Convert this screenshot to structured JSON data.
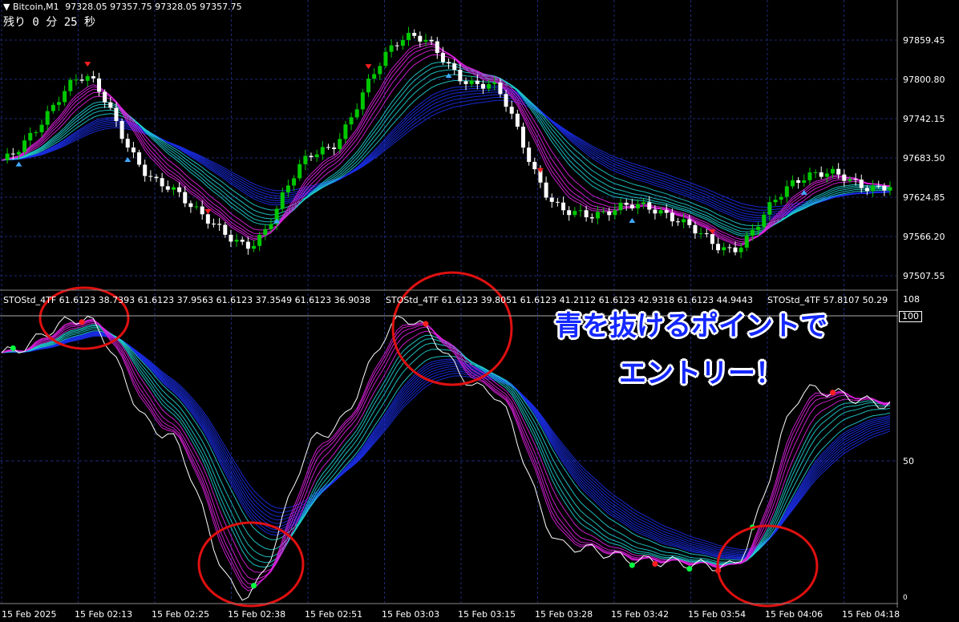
{
  "header": {
    "symbol": "Bitcoin,M1",
    "ohlc": "97328.05 97357.75 97328.05 97357.75",
    "timer": "残り 0 分 25 秒"
  },
  "price_axis": [
    "97859.45",
    "97800.80",
    "97742.15",
    "97683.50",
    "97624.85",
    "97566.20",
    "97507.55"
  ],
  "oscillator": {
    "info": [
      "STOStd_4TF 61.6123 38.7393 61.6123 37.9563 61.6123 37.3549 61.6123 36.9038",
      "STOStd_4TF 61.6123 39.8051 61.6123 41.2112 61.6123 42.9318 61.6123 44.9443",
      "STOStd_4TF 57.8107 50.29"
    ],
    "levels": [
      "108",
      "100",
      "50",
      "0"
    ]
  },
  "time_axis": [
    "15 Feb 2025",
    "15 Feb 02:13",
    "15 Feb 02:25",
    "15 Feb 02:38",
    "15 Feb 02:51",
    "15 Feb 03:03",
    "15 Feb 03:15",
    "15 Feb 03:28",
    "15 Feb 03:42",
    "15 Feb 03:54",
    "15 Feb 04:06",
    "15 Feb 04:18"
  ],
  "annotation": {
    "line1": "青を抜けるポイントで",
    "line2": "エントリー！"
  },
  "colors": {
    "background": "#000000",
    "bull_candle": "#00c800",
    "bear_candle": "#ffffff",
    "grid": "#1e2a78",
    "ribbon_blue": "#1b2ee8",
    "ribbon_magenta": "#e020e0",
    "ribbon_cyan": "#20d0d0",
    "circle": "#e01010",
    "callout_text": "#1428ff"
  },
  "chart_data": {
    "type": "line",
    "title": "Bitcoin,M1",
    "x": [
      "15 Feb 2025",
      "15 Feb 02:13",
      "15 Feb 02:25",
      "15 Feb 02:38",
      "15 Feb 02:51",
      "15 Feb 03:03",
      "15 Feb 03:15",
      "15 Feb 03:28",
      "15 Feb 03:42",
      "15 Feb 03:54",
      "15 Feb 04:06",
      "15 Feb 04:18"
    ],
    "price_ylim": [
      97490,
      97900
    ],
    "price_close_approx": [
      97680,
      97800,
      97640,
      97555,
      97700,
      97865,
      97790,
      97600,
      97610,
      97550,
      97660,
      97640
    ],
    "oscillator_ylim": [
      0,
      108
    ],
    "oscillator_levels": [
      50,
      100
    ],
    "oscillator_approx": [
      88,
      100,
      60,
      3,
      60,
      100,
      75,
      20,
      15,
      13,
      75,
      70
    ],
    "grid": true
  }
}
